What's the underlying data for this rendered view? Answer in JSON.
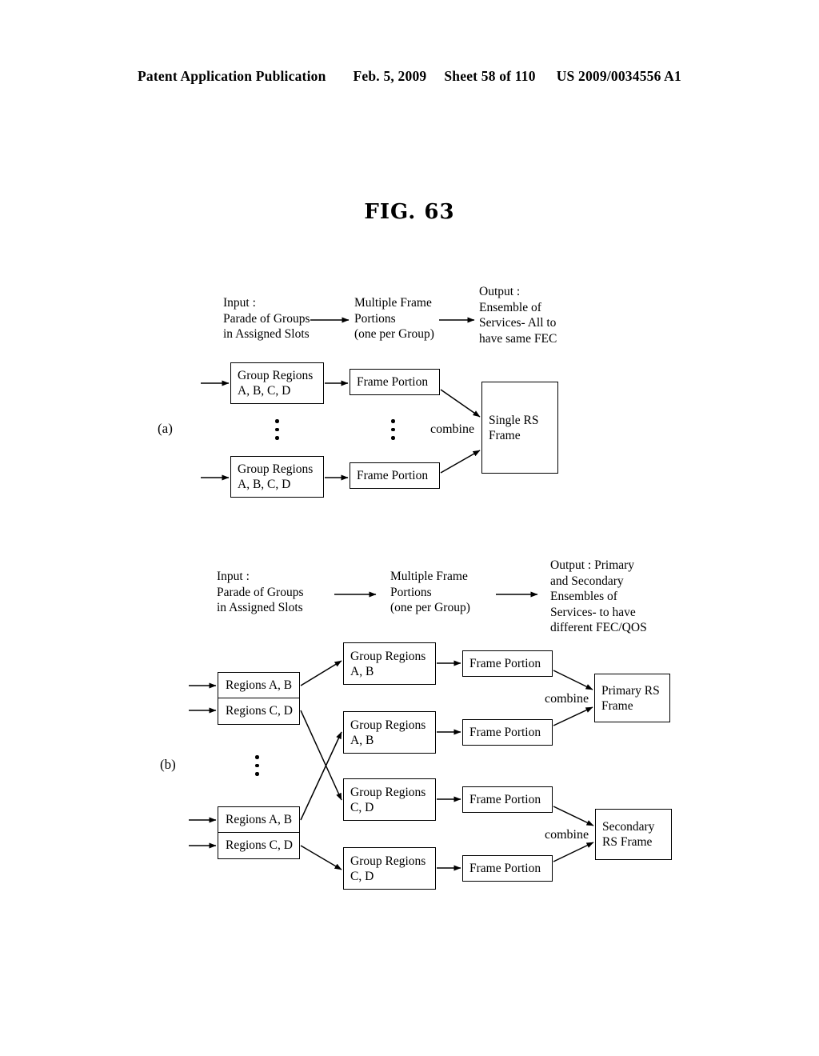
{
  "header": {
    "publication": "Patent Application Publication",
    "date": "Feb. 5, 2009",
    "sheet": "Sheet 58 of 110",
    "patent_number": "US 2009/0034556 A1"
  },
  "figure": {
    "title": "FIG. 63"
  },
  "section_a": {
    "letter": "(a)",
    "stage_labels": {
      "input": "Input :\nParade of Groups\nin Assigned Slots",
      "middle": "Multiple Frame\nPortions\n(one per Group)",
      "output": "Output :\nEnsemble of\nServices- All to\nhave same FEC"
    },
    "group_region_boxes": [
      {
        "line1": "Group Regions",
        "line2": "A, B, C, D"
      },
      {
        "line1": "Group Regions",
        "line2": "A, B, C, D"
      }
    ],
    "frame_portion_boxes": [
      {
        "label": "Frame Portion"
      },
      {
        "label": "Frame Portion"
      }
    ],
    "combine_label": "combine",
    "rs_frame": {
      "line1": "Single RS",
      "line2": "Frame"
    },
    "ellipsis": "⋮"
  },
  "section_b": {
    "letter": "(b)",
    "stage_labels": {
      "input": "Input :\nParade of Groups\nin Assigned Slots",
      "middle": "Multiple Frame\nPortions\n(one per Group)",
      "output": "Output : Primary\nand Secondary\nEnsembles of\nServices- to have\ndifferent FEC/QOS"
    },
    "region_stacks": [
      {
        "top": "Regions A, B",
        "bottom": "Regions C, D"
      },
      {
        "top": "Regions A, B",
        "bottom": "Regions C, D"
      }
    ],
    "group_region_boxes": [
      {
        "line1": "Group Regions",
        "line2": "A, B"
      },
      {
        "line1": "Group Regions",
        "line2": "A, B"
      },
      {
        "line1": "Group Regions",
        "line2": "C, D"
      },
      {
        "line1": "Group Regions",
        "line2": "C, D"
      }
    ],
    "frame_portion_boxes": [
      {
        "label": "Frame Portion"
      },
      {
        "label": "Frame Portion"
      },
      {
        "label": "Frame Portion"
      },
      {
        "label": "Frame Portion"
      }
    ],
    "combine_labels": [
      "combine",
      "combine"
    ],
    "rs_frames": [
      {
        "line1": "Primary RS",
        "line2": "Frame"
      },
      {
        "line1": "Secondary",
        "line2": "RS Frame"
      }
    ],
    "ellipsis": "⋮"
  }
}
